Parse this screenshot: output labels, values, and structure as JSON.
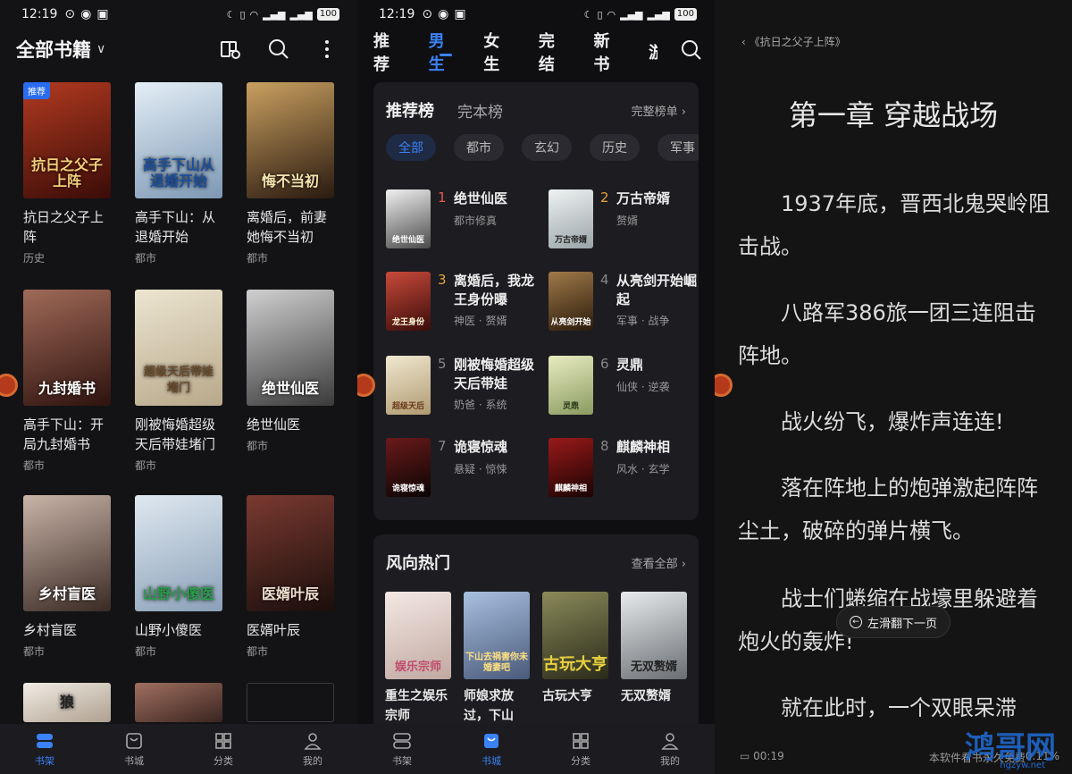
{
  "status": {
    "time": "12:19",
    "battery": "100"
  },
  "shelf": {
    "title": "全部书籍",
    "tag_recommend": "推荐",
    "books": [
      {
        "title": "抗日之父子上阵",
        "cover_text": "抗日之父子上阵",
        "category": "历史",
        "color": "#7a1d12"
      },
      {
        "title": "高手下山：从退婚开始",
        "cover_text": "高手下山从退婚开始",
        "category": "都市",
        "color": "#9bb3c9"
      },
      {
        "title": "离婚后，前妻她悔不当初",
        "cover_text": "悔不当初",
        "category": "都市",
        "color": "#5a4632"
      },
      {
        "title": "高手下山：开局九封婚书",
        "cover_text": "九封婚书",
        "category": "都市",
        "color": "#5a2a24"
      },
      {
        "title": "刚被悔婚超级天后带娃堵门",
        "cover_text": "超级天后带娃堵门",
        "category": "都市",
        "color": "#c9c1a8"
      },
      {
        "title": "绝世仙医",
        "cover_text": "绝世仙医",
        "category": "都市",
        "color": "#6e6e6e"
      },
      {
        "title": "乡村盲医",
        "cover_text": "乡村盲医",
        "category": "都市",
        "color": "#7a6a60"
      },
      {
        "title": "山野小傻医",
        "cover_text": "山野小傻医",
        "category": "都市",
        "color": "#8fa2b5"
      },
      {
        "title": "医婿叶辰",
        "cover_text": "医婿叶辰",
        "category": "都市",
        "color": "#3a2a26"
      },
      {
        "title": "",
        "cover_text": "狼",
        "category": "",
        "color": "#e8e2d8"
      },
      {
        "title": "",
        "cover_text": "",
        "category": "",
        "color": "#5a3a2c"
      }
    ]
  },
  "nav1": {
    "items": [
      {
        "label": "书架"
      },
      {
        "label": "书城"
      },
      {
        "label": "分类"
      },
      {
        "label": "我的"
      }
    ]
  },
  "store": {
    "tabs": [
      "推荐",
      "男生",
      "女生",
      "完结",
      "新书",
      "游"
    ],
    "rank_title": "推荐榜",
    "rank_alt": "完本榜",
    "rank_more": "完整榜单",
    "chips": [
      "全部",
      "都市",
      "玄幻",
      "历史",
      "军事"
    ],
    "ranks": [
      {
        "num": "1",
        "title": "绝世仙医",
        "sub": "都市修真",
        "cover": "绝世仙医",
        "color": "#d8d8d8"
      },
      {
        "num": "2",
        "title": "万古帝婿",
        "sub": "赘婿",
        "cover": "万古帝婿",
        "color": "#cfd6d8"
      },
      {
        "num": "3",
        "title": "离婚后，我龙王身份曝",
        "sub": "神医 · 赘婿",
        "cover": "龙王身份",
        "color": "#8a2a2a"
      },
      {
        "num": "4",
        "title": "从亮剑开始崛起",
        "sub": "军事 · 战争",
        "cover": "从亮剑开始",
        "color": "#6a4a2a"
      },
      {
        "num": "5",
        "title": "刚被悔婚超级天后带娃",
        "sub": "奶爸 · 系统",
        "cover": "超级天后",
        "color": "#d9cfb4"
      },
      {
        "num": "6",
        "title": "灵鼎",
        "sub": "仙侠 · 逆袭",
        "cover": "灵鼎",
        "color": "#c8d0a0"
      },
      {
        "num": "7",
        "title": "诡寝惊魂",
        "sub": "悬疑 · 惊悚",
        "cover": "诡寝惊魂",
        "color": "#3a1010"
      },
      {
        "num": "8",
        "title": "麒麟神相",
        "sub": "风水 · 玄学",
        "cover": "麒麟神相",
        "color": "#4a0a0a"
      }
    ],
    "hot_title": "风向热门",
    "hot_more": "查看全部",
    "hot": [
      {
        "title": "重生之娱乐宗师",
        "cover": "娱乐宗师",
        "color": "#e9d8d0"
      },
      {
        "title": "师娘求放过，下山",
        "cover": "下山去祸害你未婚妻吧",
        "color": "#7b8fb0"
      },
      {
        "title": "古玩大亨",
        "cover": "古玩大亨",
        "color": "#4a4a2e"
      },
      {
        "title": "无双赘婿",
        "cover": "无双赘婿",
        "color": "#c0c4c8"
      }
    ]
  },
  "nav2": {
    "items": [
      {
        "label": "书架"
      },
      {
        "label": "书城"
      },
      {
        "label": "分类"
      },
      {
        "label": "我的"
      }
    ]
  },
  "reader": {
    "book": "《抗日之父子上阵》",
    "chapter": "第一章 穿越战场",
    "paragraphs": [
      "1937年底，晋西北鬼哭岭阻击战。",
      "八路军386旅一团三连阻击阵地。",
      "战火纷飞，爆炸声连连!",
      "落在阵地上的炮弹激起阵阵尘土，破碎的弹片横飞。",
      "战士们蜷缩在战壕里躲避着炮火的轰炸!",
      "就在此时，一个双眼呆滞"
    ],
    "toast": "左滑翻下一页",
    "footer_time": "00:19",
    "footer_right": "本软件看书永久免费",
    "progress": "0.11%",
    "watermark": "鸿哥网",
    "watermark_sub": "hgzyw.net"
  },
  "colors": {
    "accent": "#3b82f6",
    "rank_top": "#e85a4f",
    "rank_mid": "#e8a33f"
  }
}
